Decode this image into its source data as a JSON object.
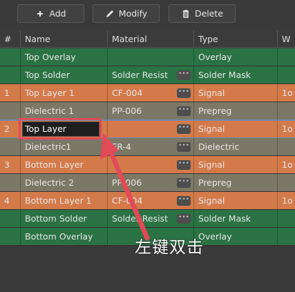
{
  "toolbar": {
    "add_label": "Add",
    "modify_label": "Modify",
    "delete_label": "Delete"
  },
  "table": {
    "columns": [
      "#",
      "Name",
      "Material",
      "Type",
      "W"
    ],
    "rows": [
      {
        "num": "",
        "name": "Top Overlay",
        "material": "",
        "type": "Overlay",
        "w": "",
        "style": "green",
        "has_ellipsis": false
      },
      {
        "num": "",
        "name": "Top Solder",
        "material": "Solder Resist",
        "type": "Solder Mask",
        "w": "",
        "style": "green",
        "has_ellipsis": true
      },
      {
        "num": "1",
        "name": "Top Layer 1",
        "material": "CF-004",
        "type": "Signal",
        "w": "1o",
        "style": "orange",
        "has_ellipsis": true
      },
      {
        "num": "",
        "name": "Dielectric 1",
        "material": "PP-006",
        "type": "Prepreg",
        "w": "",
        "style": "gray",
        "has_ellipsis": true
      },
      {
        "num": "2",
        "name": "Top Layer",
        "material": "",
        "type": "Signal",
        "w": "1o",
        "style": "selected",
        "has_ellipsis": true
      },
      {
        "num": "",
        "name": "Dielectric1",
        "material": "FR-4",
        "type": "Dielectric",
        "w": "",
        "style": "gray",
        "has_ellipsis": true
      },
      {
        "num": "3",
        "name": "Bottom Layer",
        "material": "",
        "type": "Signal",
        "w": "1o",
        "style": "orange",
        "has_ellipsis": true
      },
      {
        "num": "",
        "name": "Dielectric 2",
        "material": "PP-006",
        "type": "Prepreg",
        "w": "",
        "style": "gray",
        "has_ellipsis": true
      },
      {
        "num": "4",
        "name": "Bottom Layer 1",
        "material": "CF-004",
        "type": "Signal",
        "w": "1o",
        "style": "orange",
        "has_ellipsis": true
      },
      {
        "num": "",
        "name": "Bottom Solder",
        "material": "Solder Resist",
        "type": "Solder Mask",
        "w": "",
        "style": "green",
        "has_ellipsis": true
      },
      {
        "num": "",
        "name": "Bottom Overlay",
        "material": "",
        "type": "Overlay",
        "w": "",
        "style": "green",
        "has_ellipsis": false
      }
    ]
  },
  "annotation": {
    "text": "左键双击",
    "color": "#e04b57"
  },
  "colors": {
    "green": "#2b7244",
    "orange": "#d47a4a",
    "gray": "#7c7867",
    "background": "#3a3a3a"
  },
  "icons": {
    "add": "plus-icon",
    "modify": "pencil-icon",
    "delete": "trash-icon"
  }
}
